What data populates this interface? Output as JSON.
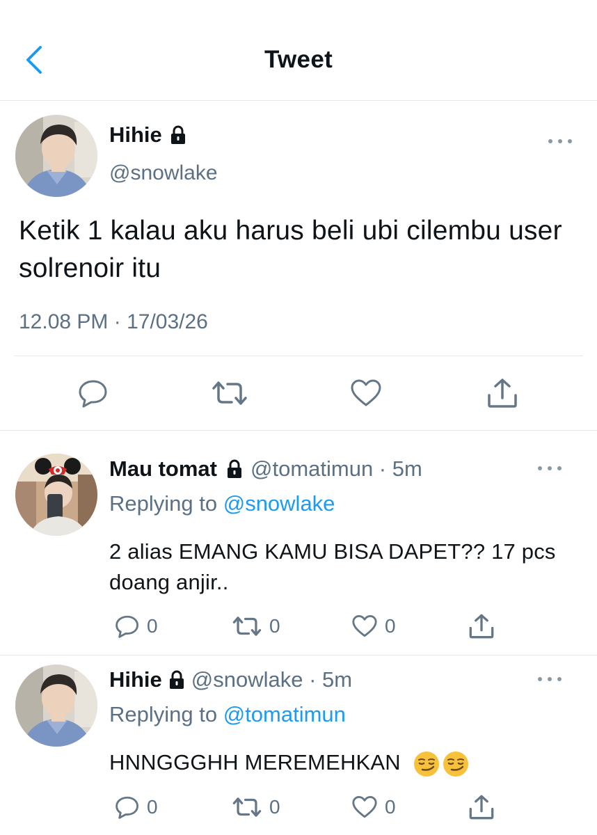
{
  "header": {
    "title": "Tweet"
  },
  "main_tweet": {
    "name": "Hihie",
    "handle": "@snowlake",
    "text": "Ketik 1 kalau aku harus beli ubi cilembu user solrenoir itu",
    "timestamp": "12.08 PM · 17/03/26"
  },
  "replies": [
    {
      "name": "Mau tomat",
      "handle": "@tomatimun · 5m",
      "replying_label": "Replying to ",
      "replying_to": "@snowlake",
      "text": "2 alias EMANG KAMU BISA DAPET?? 17 pcs doang anjir..",
      "counts": {
        "reply": "0",
        "retweet": "0",
        "like": "0"
      }
    },
    {
      "name": "Hihie",
      "handle": "@snowlake · 5m",
      "replying_label": "Replying to ",
      "replying_to": "@tomatimun",
      "text": "HNNGGGHH MEREMEHKAN",
      "emojis": [
        "smirking-face",
        "smirking-face"
      ],
      "counts": {
        "reply": "0",
        "retweet": "0",
        "like": "0"
      }
    }
  ],
  "colors": {
    "link": "#1d9bf0",
    "secondary": "#5b7083",
    "icon": "#657786",
    "divider": "#e6e9ec"
  }
}
